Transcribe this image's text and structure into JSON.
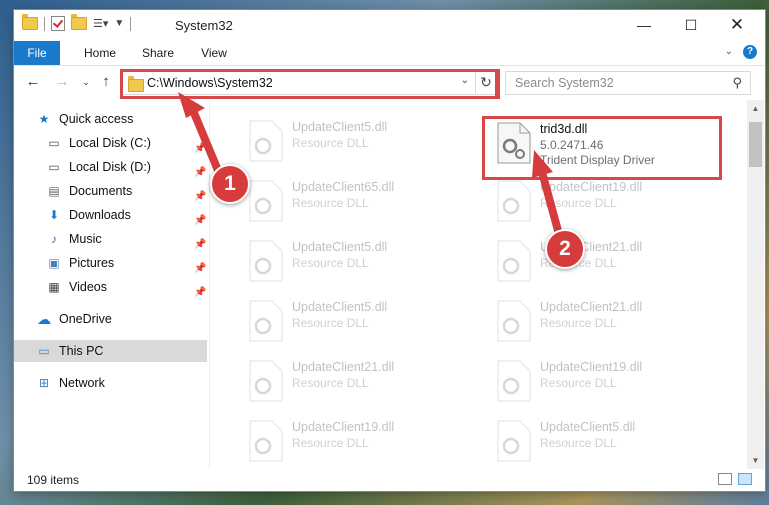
{
  "window": {
    "title": "System32"
  },
  "ribbon": {
    "tabs": [
      "File",
      "Home",
      "Share",
      "View"
    ]
  },
  "address": {
    "path": "C:\\Windows\\System32"
  },
  "search": {
    "placeholder": "Search System32"
  },
  "sidebar": {
    "items": [
      {
        "label": "Quick access",
        "icon": "star-icon",
        "pinned": false
      },
      {
        "label": "Local Disk (C:)",
        "icon": "drive-icon",
        "pinned": true
      },
      {
        "label": "Local Disk (D:)",
        "icon": "drive-icon",
        "pinned": true
      },
      {
        "label": "Documents",
        "icon": "documents-icon",
        "pinned": true
      },
      {
        "label": "Downloads",
        "icon": "downloads-icon",
        "pinned": true
      },
      {
        "label": "Music",
        "icon": "music-icon",
        "pinned": true
      },
      {
        "label": "Pictures",
        "icon": "pictures-icon",
        "pinned": true
      },
      {
        "label": "Videos",
        "icon": "videos-icon",
        "pinned": true
      },
      {
        "label": "OneDrive",
        "icon": "cloud-icon",
        "pinned": false
      },
      {
        "label": "This PC",
        "icon": "computer-icon",
        "pinned": false,
        "selected": true
      },
      {
        "label": "Network",
        "icon": "network-icon",
        "pinned": false
      }
    ]
  },
  "files": {
    "highlighted": {
      "name": "trid3d.dll",
      "version": "5.0.2471.46",
      "description": "Trident Display Driver"
    },
    "background": [
      {
        "name": "UpdateClient5.dll",
        "type": "Resource DLL"
      },
      {
        "name": "UpdateClient65.dll",
        "type": "Resource DLL"
      },
      {
        "name": "UpdateClient19.dll",
        "type": "Resource DLL"
      },
      {
        "name": "UpdateClient5.dll",
        "type": "Resource DLL"
      },
      {
        "name": "UpdateClient21.dll",
        "type": "Resource DLL"
      },
      {
        "name": "UpdateClient5.dll",
        "type": "Resource DLL"
      },
      {
        "name": "UpdateClient21.dll",
        "type": "Resource DLL"
      },
      {
        "name": "UpdateClient21.dll",
        "type": "Resource DLL"
      },
      {
        "name": "UpdateClient19.dll",
        "type": "Resource DLL"
      },
      {
        "name": "UpdateClient19.dll",
        "type": "Resource DLL"
      },
      {
        "name": "UpdateClient5.dll",
        "type": "Resource DLL"
      }
    ]
  },
  "status": {
    "item_count": "109 items"
  },
  "callouts": [
    "1",
    "2"
  ],
  "colors": {
    "accent": "#1979ca",
    "highlight": "#d94848",
    "callout": "#d63c3c"
  }
}
